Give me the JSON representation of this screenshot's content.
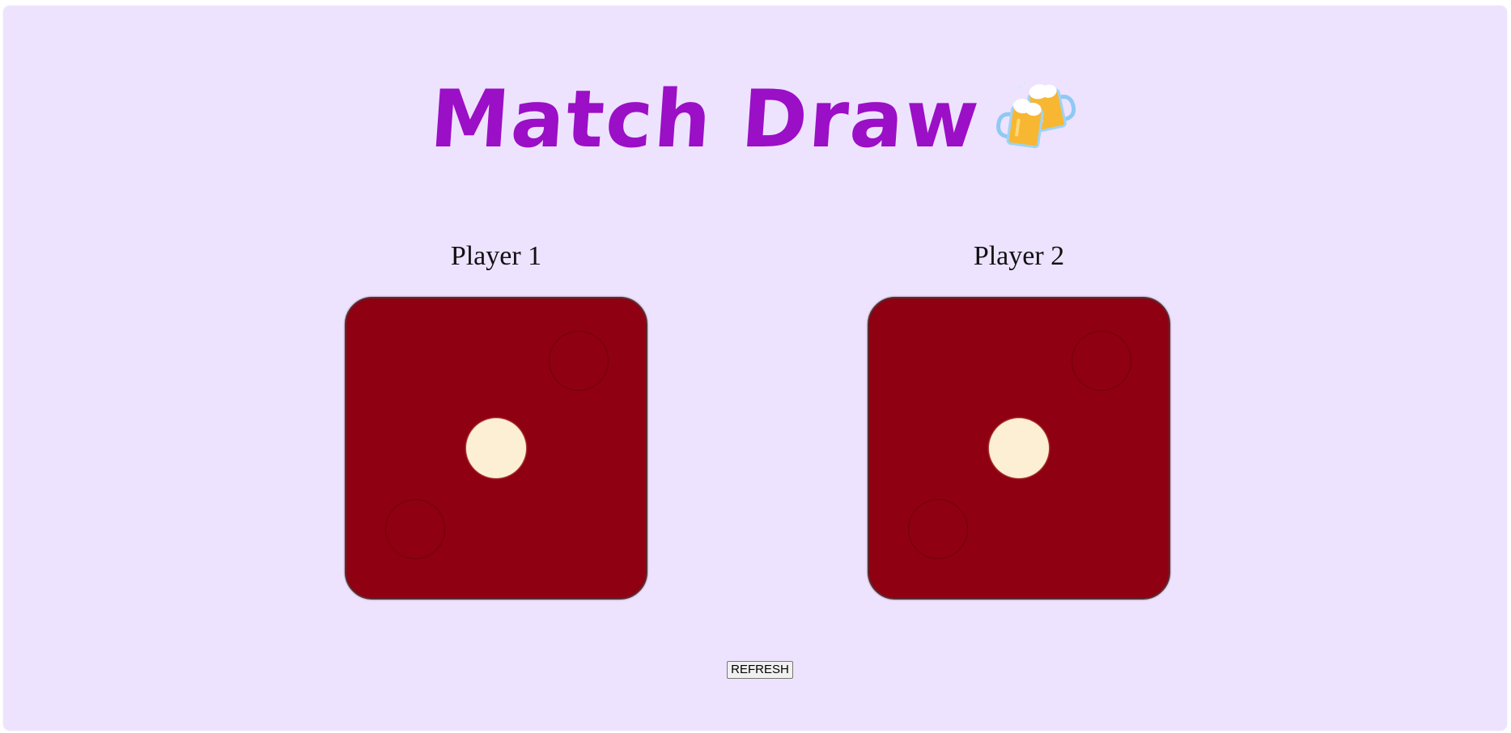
{
  "header": {
    "title": "Match Draw",
    "title_color": "#9b0fc6",
    "emoji_icon": "beer-mugs-icon"
  },
  "players": [
    {
      "label": "Player 1",
      "die_value": 1
    },
    {
      "label": "Player 2",
      "die_value": 1
    }
  ],
  "colors": {
    "background": "#ede3ff",
    "die_face": "#8f0012",
    "pip": "#fcefd3"
  },
  "controls": {
    "refresh_label": "REFRESH"
  }
}
